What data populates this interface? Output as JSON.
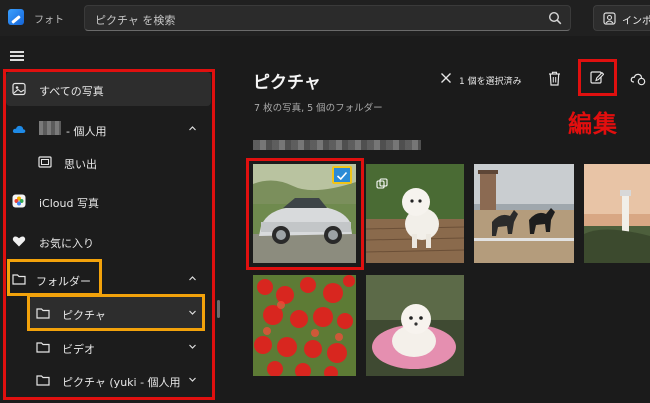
{
  "app": {
    "title": "フォト"
  },
  "search": {
    "placeholder": "ピクチャ を検索"
  },
  "toolbar": {
    "import_label": "インポート"
  },
  "sidebar": {
    "items": [
      {
        "label": "すべての写真",
        "icon": "photo-icon"
      },
      {
        "label": "- 個人用",
        "icon": "onedrive-icon"
      },
      {
        "label": "思い出",
        "icon": "memories-icon"
      },
      {
        "label": "iCloud 写真",
        "icon": "icloud-icon"
      },
      {
        "label": "お気に入り",
        "icon": "heart-icon"
      },
      {
        "label": "フォルダー",
        "icon": "folder-icon"
      },
      {
        "label": "ピクチャ",
        "icon": "folder-icon"
      },
      {
        "label": "ビデオ",
        "icon": "folder-icon"
      },
      {
        "label": "ピクチャ (yuki - 個人用",
        "icon": "folder-icon"
      }
    ]
  },
  "main": {
    "title": "ピクチャ",
    "subtitle": "7 枚の写真, 5 個のフォルダー",
    "selection": {
      "label": "1 個を選択済み"
    },
    "annotation": "編集"
  },
  "colors": {
    "accent": "#2b8bd6",
    "annotation_red": "#e0100f",
    "annotation_yellow": "#f0c419"
  }
}
